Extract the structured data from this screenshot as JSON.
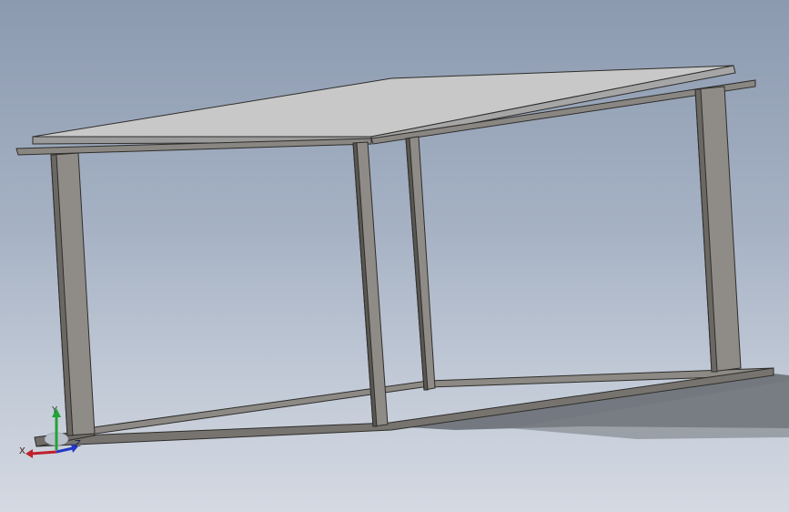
{
  "triad": {
    "x_label": "X",
    "y_label": "Y",
    "z_label": "Z",
    "colors": {
      "x": "#c0202a",
      "y": "#23a335",
      "z": "#2437c8"
    }
  },
  "model": {
    "frame_color": "#8d8a85",
    "frame_dark": "#5a5752",
    "frame_edge": "#2e2d2b",
    "top_plate_color": "#c9c9c9",
    "shadow_color": "#5e6368"
  }
}
